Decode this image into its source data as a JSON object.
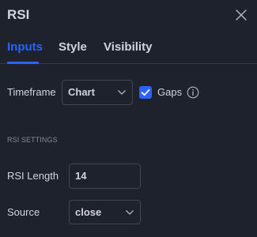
{
  "dialog": {
    "title": "RSI",
    "close_icon": "close-icon"
  },
  "tabs": [
    {
      "label": "Inputs",
      "active": true
    },
    {
      "label": "Style",
      "active": false
    },
    {
      "label": "Visibility",
      "active": false
    }
  ],
  "timeframe": {
    "label": "Timeframe",
    "value": "Chart",
    "gaps_label": "Gaps",
    "gaps_checked": true,
    "info_icon": "info-icon"
  },
  "rsi_settings": {
    "section_title": "RSI SETTINGS",
    "length_label": "RSI Length",
    "length_value": "14",
    "source_label": "Source",
    "source_value": "close"
  },
  "colors": {
    "background": "#1e222d",
    "accent": "#2962ff",
    "text": "#d1d4dc",
    "muted": "#868993",
    "border": "#434651"
  }
}
